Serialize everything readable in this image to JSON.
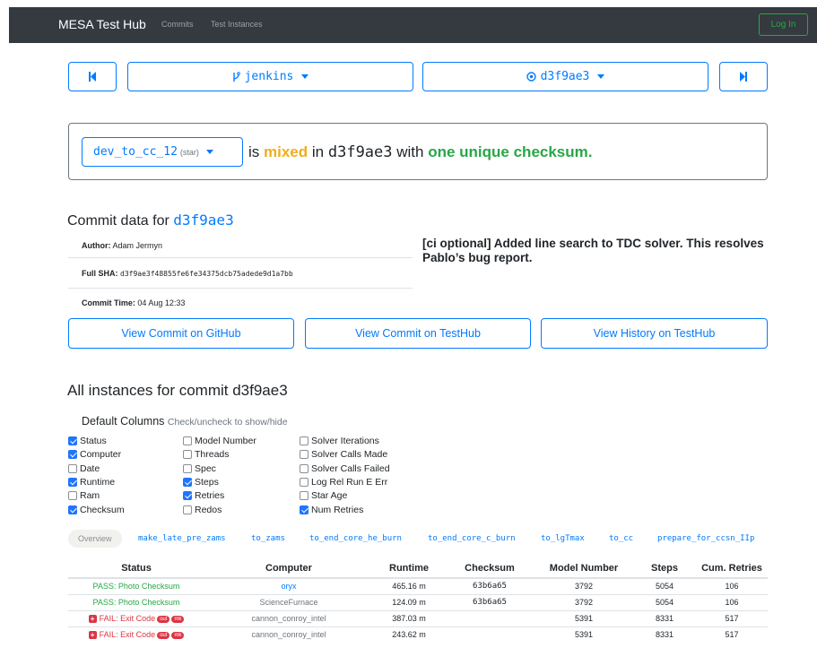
{
  "navbar": {
    "brand": "MESA Test Hub",
    "links": [
      "Commits",
      "Test Instances"
    ],
    "login": "Log In"
  },
  "nav": {
    "branch": "jenkins",
    "commit": "d3f9ae3"
  },
  "status": {
    "test_name": "dev_to_cc_12",
    "test_tag": "(star)",
    "is": "is",
    "mixed": "mixed",
    "in_word": "in",
    "commit": "d3f9ae3",
    "with": "with",
    "unique": "one unique checksum."
  },
  "commit": {
    "title_prefix": "Commit data for",
    "sha_short": "d3f9ae3",
    "author_label": "Author:",
    "author": "Adam Jermyn",
    "sha_label": "Full SHA:",
    "sha_full": "d3f9ae3f48855fe6fe34375dcb75adede9d1a7bb",
    "time_label": "Commit Time:",
    "time": "04 Aug 12:33",
    "message": "[ci optional] Added line search to TDC solver. This resolves Pablo’s bug report.",
    "buttons": [
      "View Commit on GitHub",
      "View Commit on TestHub",
      "View History on TestHub"
    ]
  },
  "instances": {
    "title": "All instances for commit d3f9ae3",
    "columns_title": "Default Columns",
    "columns_hint": "Check/uncheck to show/hide",
    "checkboxes": [
      {
        "label": "Status",
        "checked": true
      },
      {
        "label": "Computer",
        "checked": true
      },
      {
        "label": "Date",
        "checked": false
      },
      {
        "label": "Runtime",
        "checked": true
      },
      {
        "label": "Ram",
        "checked": false
      },
      {
        "label": "Checksum",
        "checked": true
      },
      {
        "label": "Model Number",
        "checked": false
      },
      {
        "label": "Threads",
        "checked": false
      },
      {
        "label": "Spec",
        "checked": false
      },
      {
        "label": "Steps",
        "checked": true
      },
      {
        "label": "Retries",
        "checked": true
      },
      {
        "label": "Redos",
        "checked": false
      },
      {
        "label": "Solver Iterations",
        "checked": false
      },
      {
        "label": "Solver Calls Made",
        "checked": false
      },
      {
        "label": "Solver Calls Failed",
        "checked": false
      },
      {
        "label": "Log Rel Run E Err",
        "checked": false
      },
      {
        "label": "Star Age",
        "checked": false
      },
      {
        "label": "Num Retries",
        "checked": true
      }
    ],
    "tabs": [
      "Overview",
      "make_late_pre_zams",
      "to_zams",
      "to_end_core_he_burn",
      "to_end_core_c_burn",
      "to_lgTmax",
      "to_cc",
      "prepare_for_ccsn_IIp"
    ],
    "headers": [
      "Status",
      "Computer",
      "Runtime",
      "Checksum",
      "Model Number",
      "Steps",
      "Cum. Retries"
    ],
    "rows": [
      {
        "status": "PASS: Photo Checksum",
        "computer": "oryx",
        "runtime": "465.16 m",
        "checksum": "63b6a65",
        "model": "3792",
        "steps": "5054",
        "retries": "106"
      },
      {
        "status": "PASS: Photo Checksum",
        "computer": "ScienceFurnace",
        "runtime": "124.09 m",
        "checksum": "63b6a65",
        "model": "3792",
        "steps": "5054",
        "retries": "106"
      },
      {
        "status": "FAIL: Exit Code",
        "computer": "cannon_conroy_intel",
        "runtime": "387.03 m",
        "checksum": "",
        "model": "5391",
        "steps": "8331",
        "retries": "517"
      },
      {
        "status": "FAIL: Exit Code",
        "computer": "cannon_conroy_intel",
        "runtime": "243.62 m",
        "checksum": "",
        "model": "5391",
        "steps": "8331",
        "retries": "517"
      }
    ],
    "pills": [
      "out",
      "mk"
    ]
  },
  "colors": {
    "accent": "#007bff",
    "pass": "#28a745",
    "fail": "#dc3545",
    "mixed": "#f0ad1e",
    "navbar": "#343a40"
  }
}
